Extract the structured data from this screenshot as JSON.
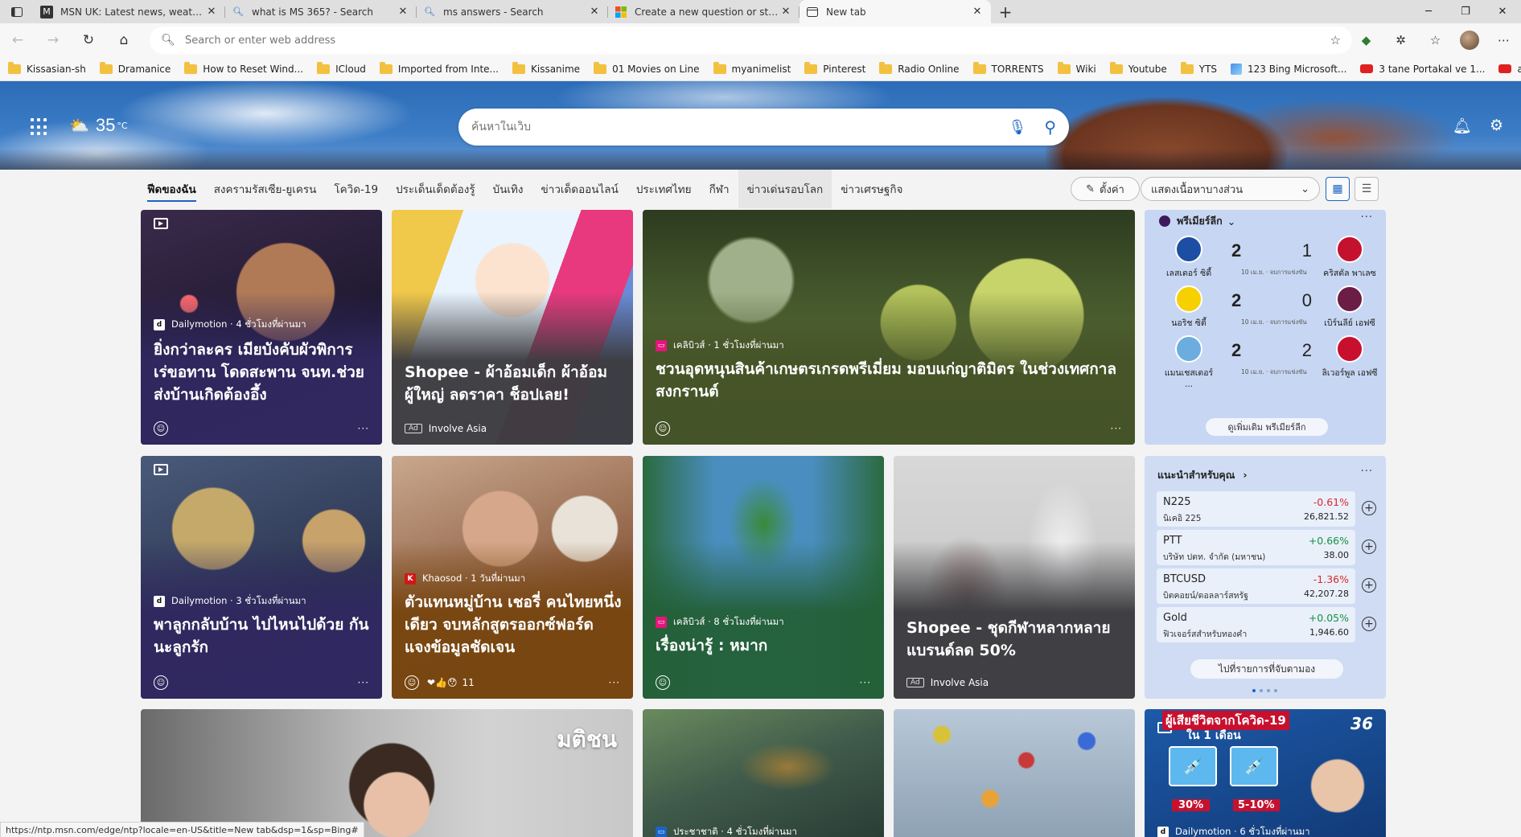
{
  "tabs": [
    {
      "title": "MSN UK: Latest news, weather, h",
      "fav": "msn-icon"
    },
    {
      "title": "what is MS 365? - Search",
      "fav": "search-icon"
    },
    {
      "title": "ms answers - Search",
      "fav": "search-icon"
    },
    {
      "title": "Create a new question or start a",
      "fav": "microsoft-icon"
    },
    {
      "title": "New tab",
      "fav": "newtab-icon"
    }
  ],
  "address": {
    "placeholder": "Search or enter web address"
  },
  "bookmarks": [
    {
      "label": "Kissasian-sh",
      "type": "folder"
    },
    {
      "label": "Dramanice",
      "type": "folder"
    },
    {
      "label": "How to Reset Wind...",
      "type": "folder"
    },
    {
      "label": "ICloud",
      "type": "folder"
    },
    {
      "label": "Imported from Inte...",
      "type": "folder"
    },
    {
      "label": "Kissanime",
      "type": "folder"
    },
    {
      "label": "01 Movies on Line",
      "type": "folder"
    },
    {
      "label": "myanimelist",
      "type": "folder"
    },
    {
      "label": "Pinterest",
      "type": "folder"
    },
    {
      "label": "Radio Online",
      "type": "folder"
    },
    {
      "label": "TORRENTS",
      "type": "folder"
    },
    {
      "label": "Wiki",
      "type": "folder"
    },
    {
      "label": "Youtube",
      "type": "folder"
    },
    {
      "label": "YTS",
      "type": "folder"
    },
    {
      "label": "123 Bing Microsoft...",
      "type": "bing"
    },
    {
      "label": "3 tane Portakal ve 1...",
      "type": "youtube"
    },
    {
      "label": "a new way to grow...",
      "type": "youtube"
    }
  ],
  "hero": {
    "temperature": "35",
    "unit": "°C",
    "search_placeholder": "ค้นหาในเว็บ"
  },
  "categories": [
    {
      "label": "ฟีดของฉัน",
      "state": "active"
    },
    {
      "label": "สงครามรัสเซีย-ยูเครน",
      "state": ""
    },
    {
      "label": "โควิด-19",
      "state": ""
    },
    {
      "label": "ประเด็นเด็ดต้องรู้",
      "state": ""
    },
    {
      "label": "บันเทิง",
      "state": ""
    },
    {
      "label": "ข่าวเด็ดออนไลน์",
      "state": ""
    },
    {
      "label": "ประเทศไทย",
      "state": ""
    },
    {
      "label": "กีฬา",
      "state": ""
    },
    {
      "label": "ข่าวเด่นรอบโลก",
      "state": "hover"
    },
    {
      "label": "ข่าวเศรษฐกิจ",
      "state": ""
    }
  ],
  "personalize_label": "ตั้งค่า",
  "content_select_label": "แสดงเนื้อหาบางส่วน",
  "cards": {
    "c1": {
      "source": "Dailymotion · 4 ชั่วโมงที่ผ่านมา",
      "headline": "ยิ่งกว่าละคร เมียบังคับผัวพิการ เร่ขอทาน โดดสะพาน จนท.ช่วยส่งบ้านเกิดต้องอึ้ง",
      "logo": "d"
    },
    "c2": {
      "headline": "Shopee - ผ้าอ้อมเด็ก ผ้าอ้อมผู้ใหญ่ ลดราคา ช็อปเลย!",
      "ad": "Ad",
      "sponsor": "Involve Asia"
    },
    "c3": {
      "source": "เคลิบิวส์ · 1 ชั่วโมงที่ผ่านมา",
      "headline": "ชวนอุดหนุนสินค้าเกษตรเกรดพรีเมี่ยม มอบแก่ญาติมิตร ในช่วงเทศกาลสงกรานต์"
    },
    "c5": {
      "source": "Dailymotion · 3 ชั่วโมงที่ผ่านมา",
      "headline": "พาลูกกลับบ้าน ไปไหนไปด้วย กันนะลูกรัก",
      "logo": "d"
    },
    "c6": {
      "source": "Khaosod · 1 วันที่ผ่านมา",
      "headline": "ตัวแทนหมู่บ้าน เชอรี่ คนไทยหนึ่งเดียว จบหลักสูตรออกซ์ฟอร์ด แจงข้อมูลชัดเจน",
      "logo": "K",
      "reaction_count": "11"
    },
    "c7": {
      "source": "เคลิบิวส์ · 8 ชั่วโมงที่ผ่านมา",
      "headline": "เรื่องน่ารู้ : หมาก"
    },
    "c8": {
      "headline": "Shopee - ชุดกีฬาหลากหลายแบรนด์ลด 50%",
      "ad": "Ad",
      "sponsor": "Involve Asia"
    },
    "c11": {
      "source": "ประชาชาติ · 4 ชั่วโมงที่ผ่านมา"
    },
    "c13": {
      "source": "Dailymotion · 6 ชั่วโมงที่ผ่านมา",
      "overlay_title": "ผู้เสียชีวิตจากโควิด-19",
      "overlay_sub": "ใน 1 เดือน",
      "pct1": "30%",
      "pct2": "5-10%"
    }
  },
  "sports": {
    "league": "พรีเมียร์ลีก",
    "matches": [
      {
        "home": "เลสเตอร์ ซิตี้",
        "away": "คริสตัล พาเลซ",
        "home_score": "2",
        "away_score": "1",
        "date": "10 เม.ย. · จบการแข่งขัน",
        "home_color": "#1c4fa3",
        "away_color": "#c4122e"
      },
      {
        "home": "นอริช ซิตี้",
        "away": "เบิร์นลีย์ เอฟซี",
        "home_score": "2",
        "away_score": "0",
        "date": "10 เม.ย. · จบการแข่งขัน",
        "home_color": "#f6d000",
        "away_color": "#6c1d45"
      },
      {
        "home": "แมนเชสเตอร์ ...",
        "away": "ลิเวอร์พูล เอฟซี",
        "home_score": "2",
        "away_score": "2",
        "date": "10 เม.ย. · จบการแข่งขัน",
        "home_color": "#6caddf",
        "away_color": "#c8102e"
      }
    ],
    "see_more": "ดูเพิ่มเติม พรีเมียร์ลีก"
  },
  "finance": {
    "title": "แนะนำสำหรับคุณ",
    "stocks": [
      {
        "symbol": "N225",
        "name": "นิเคอิ 225",
        "change": "-0.61%",
        "price": "26,821.52",
        "dir": "dn"
      },
      {
        "symbol": "PTT",
        "name": "บริษัท ปตท. จำกัด (มหาชน)",
        "change": "+0.66%",
        "price": "38.00",
        "dir": "up"
      },
      {
        "symbol": "BTCUSD",
        "name": "บิตคอยน์/ดอลลาร์สหรัฐ",
        "change": "-1.36%",
        "price": "42,207.28",
        "dir": "dn"
      },
      {
        "symbol": "Gold",
        "name": "ฟิวเจอร์สสำหรับทองคำ",
        "change": "+0.05%",
        "price": "1,946.60",
        "dir": "up"
      }
    ],
    "watchlist": "ไปที่รายการที่จับตามอง"
  },
  "status_url": "https://ntp.msn.com/edge/ntp?locale=en-US&title=New tab&dsp=1&sp=Bing#",
  "colors": {
    "accent": "#1a64c4",
    "up": "#168f46",
    "down": "#d8262d"
  }
}
